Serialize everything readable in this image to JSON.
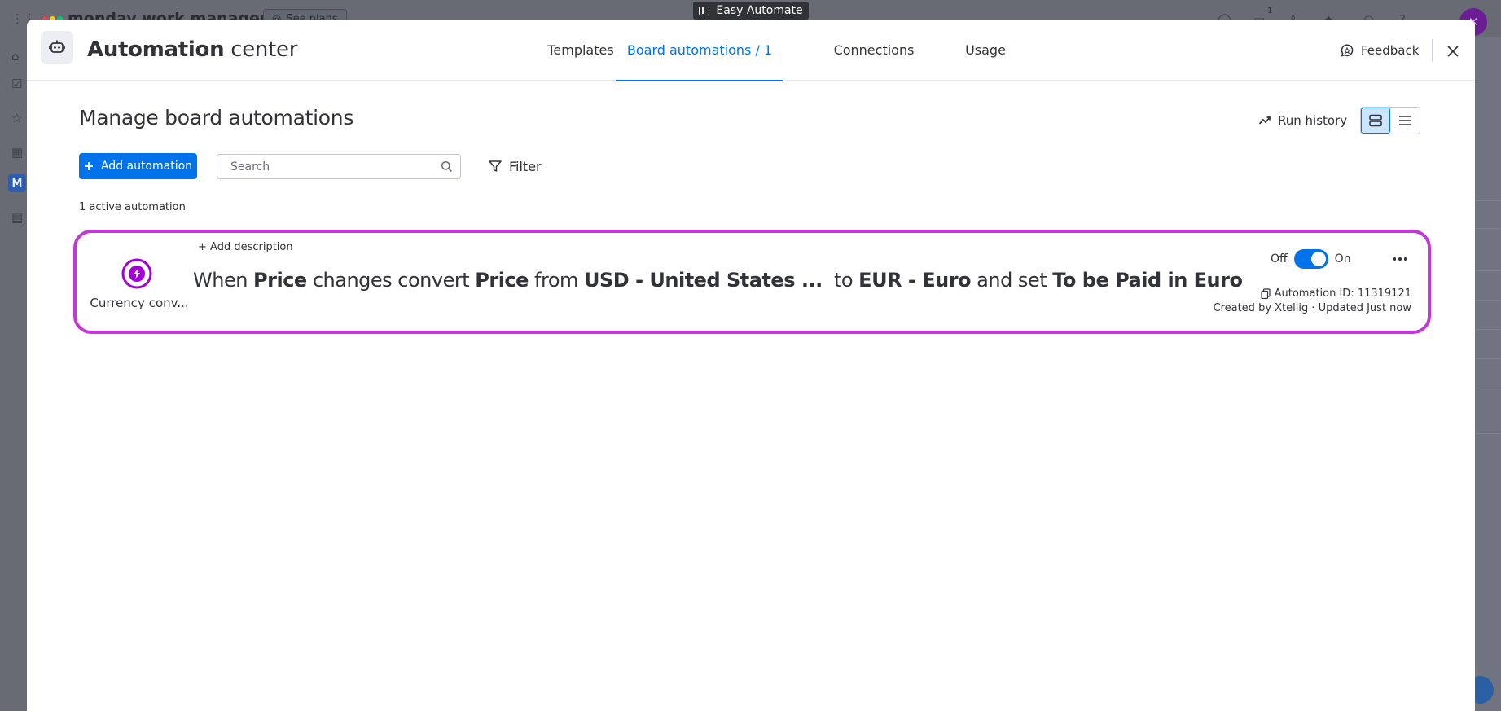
{
  "app_pill": {
    "label": "Easy Automate"
  },
  "background": {
    "brand": "monday work management",
    "see_plans": "See plans",
    "notification_count": "1",
    "workspace_initial": "M"
  },
  "modal": {
    "title_bold": "Automation",
    "title_rest": " center",
    "tabs": [
      {
        "label": "Templates"
      },
      {
        "label": "Board automations / 1"
      },
      {
        "label": "Connections"
      },
      {
        "label": "Usage"
      }
    ],
    "active_tab": "Board automations / 1",
    "feedback_label": "Feedback"
  },
  "main": {
    "page_title": "Manage board automations",
    "run_history_label": "Run history",
    "add_button_label": "Add automation",
    "search_placeholder": "Search",
    "filter_label": "Filter",
    "active_count_text": "1 active automation"
  },
  "automation": {
    "icon_label": "Currency conv...",
    "add_description": "+ Add description",
    "sentence": [
      {
        "text": "When ",
        "bold": false
      },
      {
        "text": "Price",
        "bold": true
      },
      {
        "text": " changes convert ",
        "bold": false
      },
      {
        "text": "Price",
        "bold": true
      },
      {
        "text": " from ",
        "bold": false
      },
      {
        "text": "USD - United States ...",
        "bold": true
      },
      {
        "text": "  to ",
        "bold": false
      },
      {
        "text": "EUR - Euro",
        "bold": true
      },
      {
        "text": " and set ",
        "bold": false
      },
      {
        "text": "To be Paid in Euro",
        "bold": true
      }
    ],
    "toggle_off_label": "Off",
    "toggle_on_label": "On",
    "toggle_state": "on",
    "automation_id": "Automation ID: 11319121",
    "meta": "Created by Xtellig · Updated Just now"
  },
  "colors": {
    "accent": "#0073ea",
    "highlight_border": "#c238d6",
    "icon_purple": "#a100d6"
  },
  "icons": {
    "robot": "robot-icon",
    "feedback": "chat-bubble-icon",
    "close": "close-icon",
    "run_history": "trend-line-icon",
    "card_view": "card-view-icon",
    "list_view": "list-view-icon",
    "plus": "plus-icon",
    "search": "search-icon",
    "filter": "filter-icon",
    "automation": "lightning-circle-icon",
    "copy": "copy-icon",
    "more": "more-dots-icon"
  }
}
